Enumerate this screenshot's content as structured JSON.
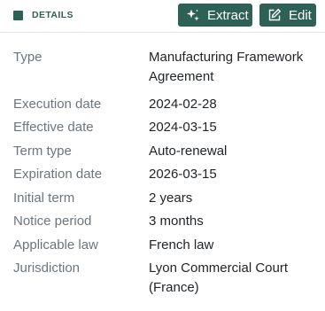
{
  "header": {
    "section_label": "DETAILS",
    "extract_label": "Extract",
    "edit_label": "Edit"
  },
  "details": {
    "type": {
      "label": "Type",
      "value": "Manufacturing Framework Agreement"
    },
    "execution_date": {
      "label": "Execution date",
      "value": "2024-02-28"
    },
    "effective_date": {
      "label": "Effective date",
      "value": "2024-03-15"
    },
    "term_type": {
      "label": "Term type",
      "value": "Auto-renewal"
    },
    "expiration_date": {
      "label": "Expiration date",
      "value": "2026-03-15"
    },
    "initial_term": {
      "label": "Initial term",
      "value": "2 years"
    },
    "notice_period": {
      "label": "Notice period",
      "value": "3 months"
    },
    "applicable_law": {
      "label": "Applicable law",
      "value": "French law"
    },
    "jurisdiction": {
      "label": "Jurisdiction",
      "value": "Lyon Commercial Court (France)"
    }
  },
  "colors": {
    "accent": "#2d6156",
    "label_text": "#6c757d",
    "value_text": "#212529"
  },
  "icons": {
    "extract": "sparkles-icon",
    "edit": "pencil-square-icon"
  }
}
